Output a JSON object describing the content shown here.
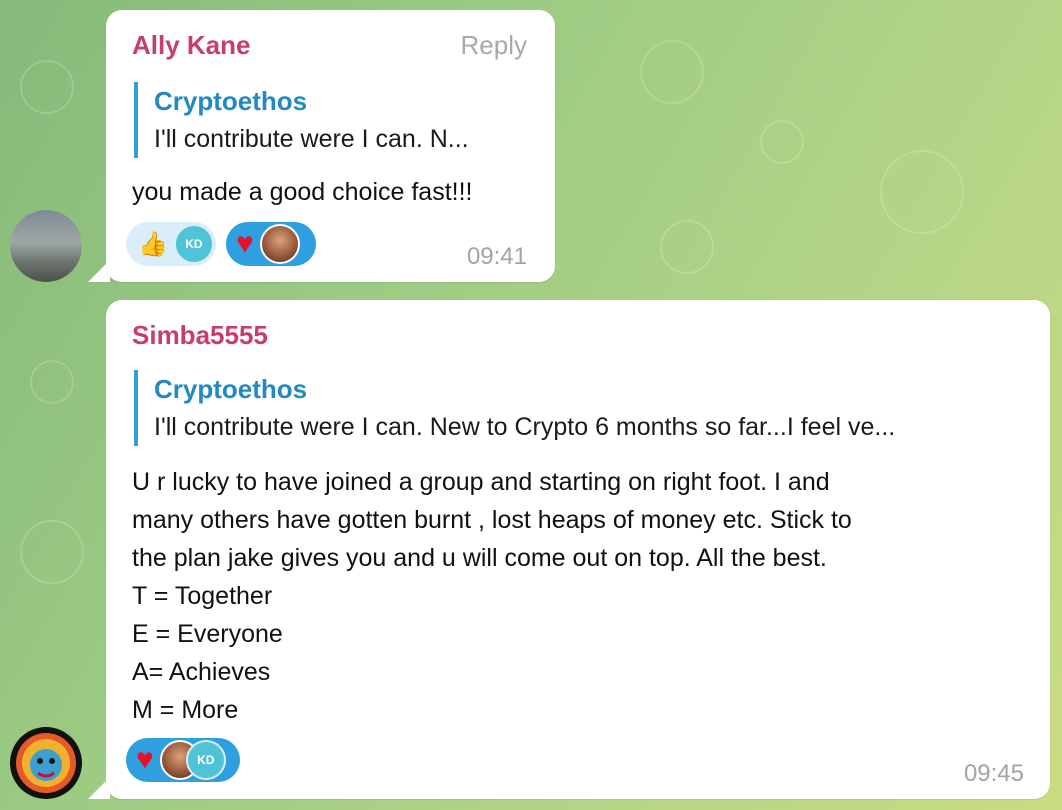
{
  "messages": [
    {
      "sender": "Ally Kane",
      "reply_action": "Reply",
      "quote": {
        "name": "Cryptoethos",
        "text": "I'll contribute were I can. N..."
      },
      "text": "you made a good choice fast!!!",
      "reactions": [
        {
          "type": "thumbs-up",
          "emoji": "👍",
          "users": [
            "KD"
          ]
        },
        {
          "type": "heart",
          "emoji": "♥",
          "users": []
        }
      ],
      "time": "09:41"
    },
    {
      "sender": "Simba5555",
      "quote": {
        "name": "Cryptoethos",
        "text": "I'll contribute were I can. New to Crypto 6 months so far...I feel ve..."
      },
      "text_lines": [
        "U r lucky to have joined a group and starting on right foot.  I and",
        "many others have gotten burnt , lost heaps of money etc.  Stick to",
        "the plan jake gives you and u will come out on top. All the best.",
        "T = Together",
        "E = Everyone",
        "A= Achieves",
        "M = More"
      ],
      "reactions": [
        {
          "type": "heart",
          "emoji": "♥",
          "users": [
            "KD"
          ]
        }
      ],
      "time": "09:45"
    }
  ],
  "colors": {
    "sender": "#c83c70",
    "quote_name": "#2389c4",
    "quote_bar": "#2d9fd6",
    "reaction_selected": "#2f9fe0",
    "reaction_default": "#d9eef9",
    "heart": "#e8112d"
  }
}
